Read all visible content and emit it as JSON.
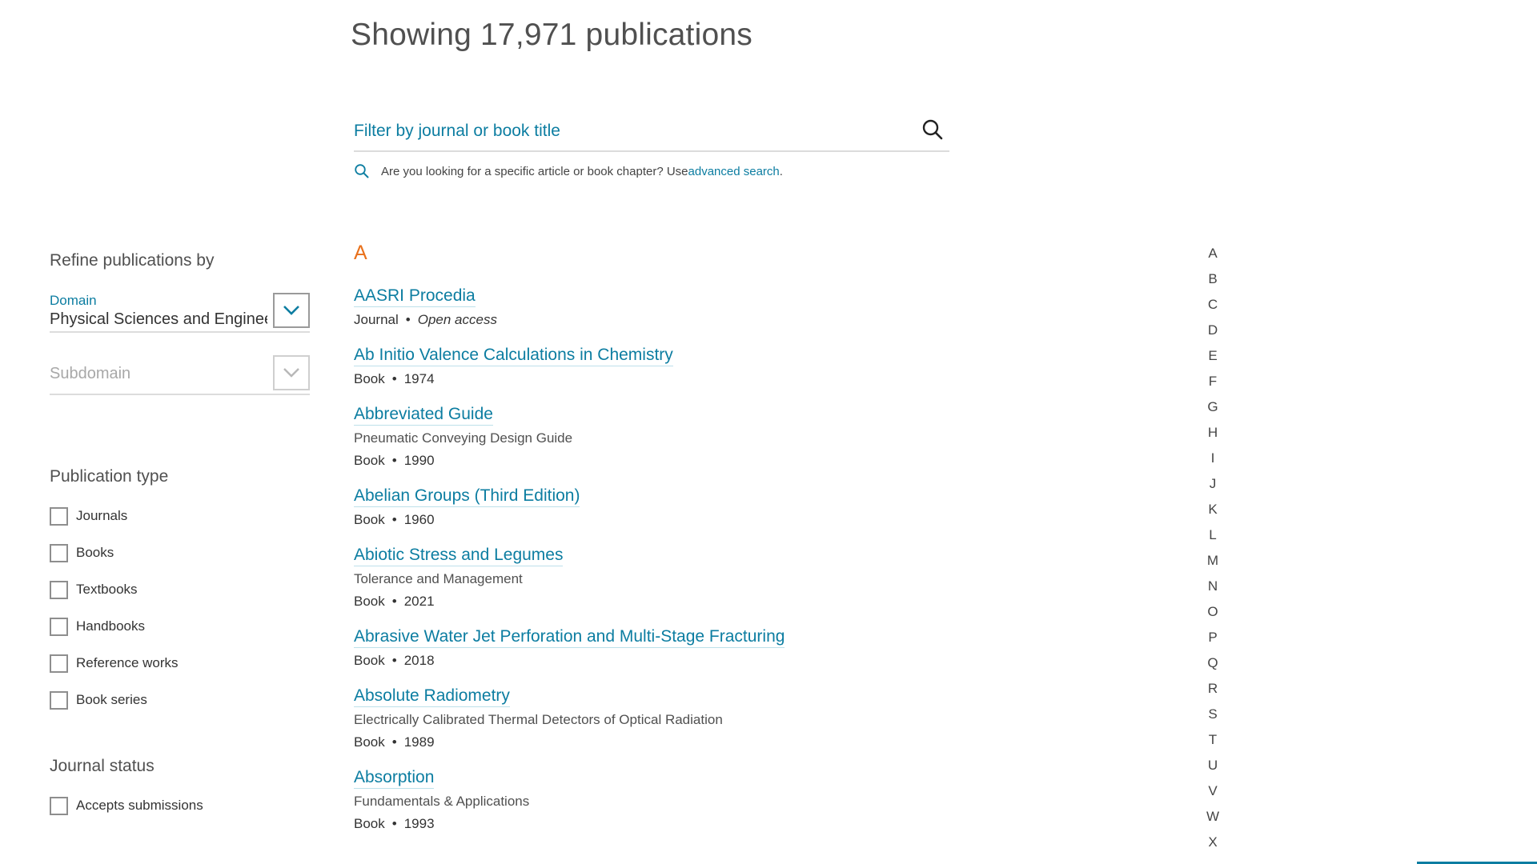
{
  "header": {
    "title": "Showing 17,971 publications"
  },
  "search": {
    "placeholder": "Filter by journal or book title",
    "hint_prefix": "Are you looking for a specific article or book chapter? Use ",
    "hint_link": "advanced search",
    "hint_suffix": "."
  },
  "sidebar": {
    "refine_title": "Refine publications by",
    "domain": {
      "label": "Domain",
      "value": "Physical Sciences and Engineering"
    },
    "subdomain": {
      "placeholder": "Subdomain"
    },
    "publication_type": {
      "title": "Publication type",
      "options": [
        "Journals",
        "Books",
        "Textbooks",
        "Handbooks",
        "Reference works",
        "Book series"
      ]
    },
    "journal_status": {
      "title": "Journal status",
      "options": [
        "Accepts submissions"
      ]
    }
  },
  "main": {
    "letter": "A",
    "publications": [
      {
        "title": "AASRI Procedia",
        "subtitle": "",
        "type": "Journal",
        "detail": "Open access"
      },
      {
        "title": "Ab Initio Valence Calculations in Chemistry",
        "subtitle": "",
        "type": "Book",
        "detail": "1974"
      },
      {
        "title": "Abbreviated Guide",
        "subtitle": "Pneumatic Conveying Design Guide",
        "type": "Book",
        "detail": "1990"
      },
      {
        "title": "Abelian Groups (Third Edition)",
        "subtitle": "",
        "type": "Book",
        "detail": "1960"
      },
      {
        "title": "Abiotic Stress and Legumes",
        "subtitle": "Tolerance and Management",
        "type": "Book",
        "detail": "2021"
      },
      {
        "title": "Abrasive Water Jet Perforation and Multi-Stage Fracturing",
        "subtitle": "",
        "type": "Book",
        "detail": "2018"
      },
      {
        "title": "Absolute Radiometry",
        "subtitle": "Electrically Calibrated Thermal Detectors of Optical Radiation",
        "type": "Book",
        "detail": "1989"
      },
      {
        "title": "Absorption",
        "subtitle": "Fundamentals & Applications",
        "type": "Book",
        "detail": "1993"
      }
    ],
    "separator": "•"
  },
  "alphabet": [
    "A",
    "B",
    "C",
    "D",
    "E",
    "F",
    "G",
    "H",
    "I",
    "J",
    "K",
    "L",
    "M",
    "N",
    "O",
    "P",
    "Q",
    "R",
    "S",
    "T",
    "U",
    "V",
    "W",
    "X"
  ],
  "colors": {
    "link": "#0c7da1",
    "letter_accent": "#e9711c",
    "text": "#2e2e2e"
  }
}
